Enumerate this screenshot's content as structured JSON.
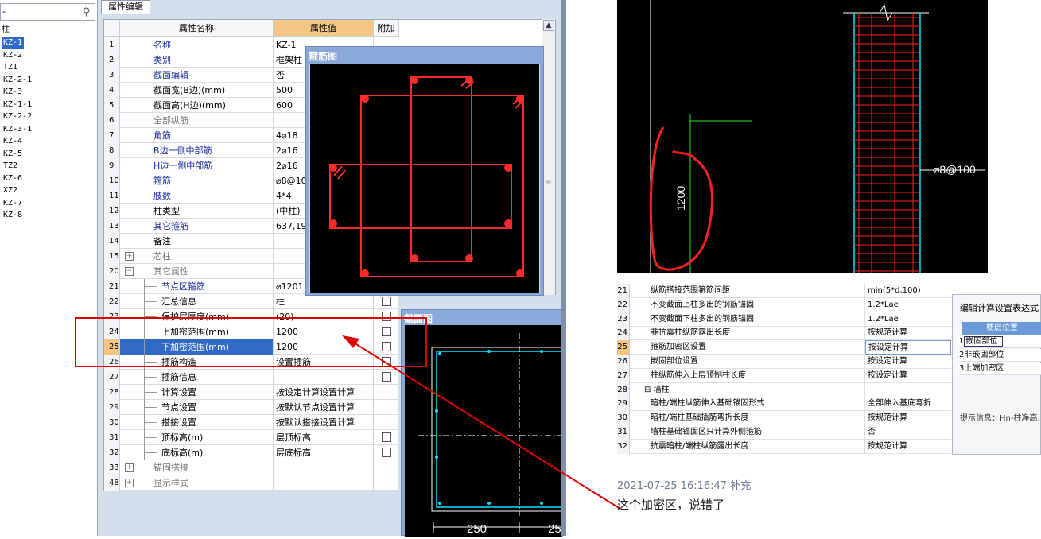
{
  "left_panel": {
    "root_label": "柱",
    "items": [
      "KZ-1",
      "KZ-2",
      "TZ1",
      "KZ-2-1",
      "KZ-3",
      "KZ-1-1",
      "KZ-2-2",
      "KZ-3-1",
      "KZ-4",
      "KZ-5",
      "TZ2",
      "KZ-6",
      "XZ2",
      "KZ-7",
      "KZ-8"
    ],
    "selected": "KZ-1"
  },
  "tab_label": "属性编辑",
  "grid": {
    "headers": {
      "name": "属性名称",
      "value": "属性值",
      "extra": "附加"
    },
    "rows": [
      {
        "num": "1",
        "name": "名称",
        "value": "KZ-1",
        "style": "blue",
        "cb": false
      },
      {
        "num": "2",
        "name": "类别",
        "value": "框架柱",
        "style": "blue",
        "cb": false
      },
      {
        "num": "3",
        "name": "截面编辑",
        "value": "否",
        "style": "blue",
        "cb": false
      },
      {
        "num": "4",
        "name": "截面宽(B边)(mm)",
        "value": "500",
        "style": "",
        "cb": false
      },
      {
        "num": "5",
        "name": "截面高(H边)(mm)",
        "value": "600",
        "style": "",
        "cb": false
      },
      {
        "num": "6",
        "name": "全部纵筋",
        "value": "",
        "style": "gray",
        "cb": false
      },
      {
        "num": "7",
        "name": "角筋",
        "value": "4⌀18",
        "style": "blue",
        "cb": false
      },
      {
        "num": "8",
        "name": "B边一侧中部筋",
        "value": "2⌀16",
        "style": "blue",
        "cb": false
      },
      {
        "num": "9",
        "name": "H边一侧中部筋",
        "value": "2⌀16",
        "style": "blue",
        "cb": false
      },
      {
        "num": "10",
        "name": "箍筋",
        "value": "⌀8@10",
        "style": "blue",
        "cb": false
      },
      {
        "num": "11",
        "name": "肢数",
        "value": "4*4",
        "style": "blue",
        "cb": false
      },
      {
        "num": "12",
        "name": "柱类型",
        "value": "(中柱)",
        "style": "",
        "cb": false
      },
      {
        "num": "13",
        "name": "其它箍筋",
        "value": "637,19",
        "style": "blue",
        "cb": false
      },
      {
        "num": "14",
        "name": "备注",
        "value": "",
        "style": "",
        "cb": false
      },
      {
        "num": "15",
        "name": "芯柱",
        "value": "",
        "style": "gray",
        "group": "+",
        "cb": false
      },
      {
        "num": "20",
        "name": "其它属性",
        "value": "",
        "style": "gray",
        "group": "-",
        "cb": false
      },
      {
        "num": "21",
        "name": "节点区箍筋",
        "value": "⌀1201",
        "style": "blue",
        "sub": true,
        "cb": false
      },
      {
        "num": "22",
        "name": "汇总信息",
        "value": "柱",
        "style": "",
        "sub": true,
        "cb": true
      },
      {
        "num": "23",
        "name": "保护层厚度(mm)",
        "value": "(20)",
        "style": "",
        "sub": true,
        "cb": true
      },
      {
        "num": "24",
        "name": "上加密范围(mm)",
        "value": "1200",
        "style": "",
        "sub": true,
        "cb": true
      },
      {
        "num": "25",
        "name": "下加密范围(mm)",
        "value": "1200",
        "style": "",
        "sub": true,
        "cb": true,
        "selected": true
      },
      {
        "num": "26",
        "name": "插筋构造",
        "value": "设置插筋",
        "style": "",
        "sub": true,
        "cb": true
      },
      {
        "num": "27",
        "name": "插筋信息",
        "value": "",
        "style": "",
        "sub": true,
        "cb": true
      },
      {
        "num": "28",
        "name": "计算设置",
        "value": "按设定计算设置计算",
        "style": "",
        "sub": true,
        "cb": false
      },
      {
        "num": "29",
        "name": "节点设置",
        "value": "按默认节点设置计算",
        "style": "",
        "sub": true,
        "cb": false
      },
      {
        "num": "30",
        "name": "搭接设置",
        "value": "按默认搭接设置计算",
        "style": "",
        "sub": true,
        "cb": false
      },
      {
        "num": "31",
        "name": "顶标高(m)",
        "value": "层顶标高",
        "style": "",
        "sub": true,
        "cb": true
      },
      {
        "num": "32",
        "name": "底标高(m)",
        "value": "层底标高",
        "style": "",
        "sub": true,
        "cb": true
      },
      {
        "num": "33",
        "name": "锚固搭接",
        "value": "",
        "style": "gray",
        "group": "+",
        "cb": false
      },
      {
        "num": "48",
        "name": "显示样式",
        "value": "",
        "style": "gray",
        "group": "+",
        "cb": false
      }
    ]
  },
  "stirrup_window": {
    "title": "箍筋图"
  },
  "section_window": {
    "title": "截面图",
    "dim1": "250",
    "dim2": "25"
  },
  "cad_right": {
    "height_label": "1200",
    "rebar_label": "⌀8@100"
  },
  "calc_table": {
    "rows": [
      {
        "num": "21",
        "key": "纵筋搭接范围箍筋间距",
        "value": "min(5*d,100)",
        "hl": false
      },
      {
        "num": "22",
        "key": "不变截面上柱多出的钢筋锚固",
        "value": "1.2*Lae",
        "hl": false
      },
      {
        "num": "23",
        "key": "不变截面下柱多出的钢筋锚固",
        "value": "1.2*Lae",
        "hl": false
      },
      {
        "num": "24",
        "key": "非抗震柱纵筋露出长度",
        "value": "按规范计算",
        "hl": false
      },
      {
        "num": "25",
        "key": "箍筋加密区设置",
        "value": "按设定计算",
        "hl": true
      },
      {
        "num": "26",
        "key": "嵌固部位设置",
        "value": "按设定计算",
        "hl": false
      },
      {
        "num": "27",
        "key": "柱纵筋伸入上层预制柱长度",
        "value": "按设定计算",
        "hl": false
      },
      {
        "num": "28",
        "key": "墙柱",
        "value": "",
        "hl": false,
        "group": true
      },
      {
        "num": "29",
        "key": "暗柱/端柱纵筋伸入基础锚固形式",
        "value": "全部伸入基底弯折",
        "hl": false
      },
      {
        "num": "30",
        "key": "暗柱/端柱基础插筋弯折长度",
        "value": "按规范计算",
        "hl": false
      },
      {
        "num": "31",
        "key": "墙柱基础锚固区只计算外侧箍筋",
        "value": "否",
        "hl": false
      },
      {
        "num": "32",
        "key": "抗震暗柱/端柱纵筋露出长度",
        "value": "按规范计算",
        "hl": false
      }
    ]
  },
  "dialog": {
    "title": "编辑计算设置表达式",
    "col_header": "楼层位置",
    "rows": [
      {
        "n": "1",
        "t": "嵌固部位"
      },
      {
        "n": "2",
        "t": "非嵌固部位"
      },
      {
        "n": "3",
        "t": "上端加密区"
      }
    ],
    "tip": "提示信息：Hn-柱净高,"
  },
  "reply": {
    "timestamp": "2021-07-25 16:16:47 补充",
    "comment": "这个加密区，说错了"
  },
  "colors": {
    "highlight_red": "#e00000",
    "selection_blue": "#3169c6",
    "cad_red": "#ff2a2a",
    "cad_cyan": "#00e5ff"
  }
}
